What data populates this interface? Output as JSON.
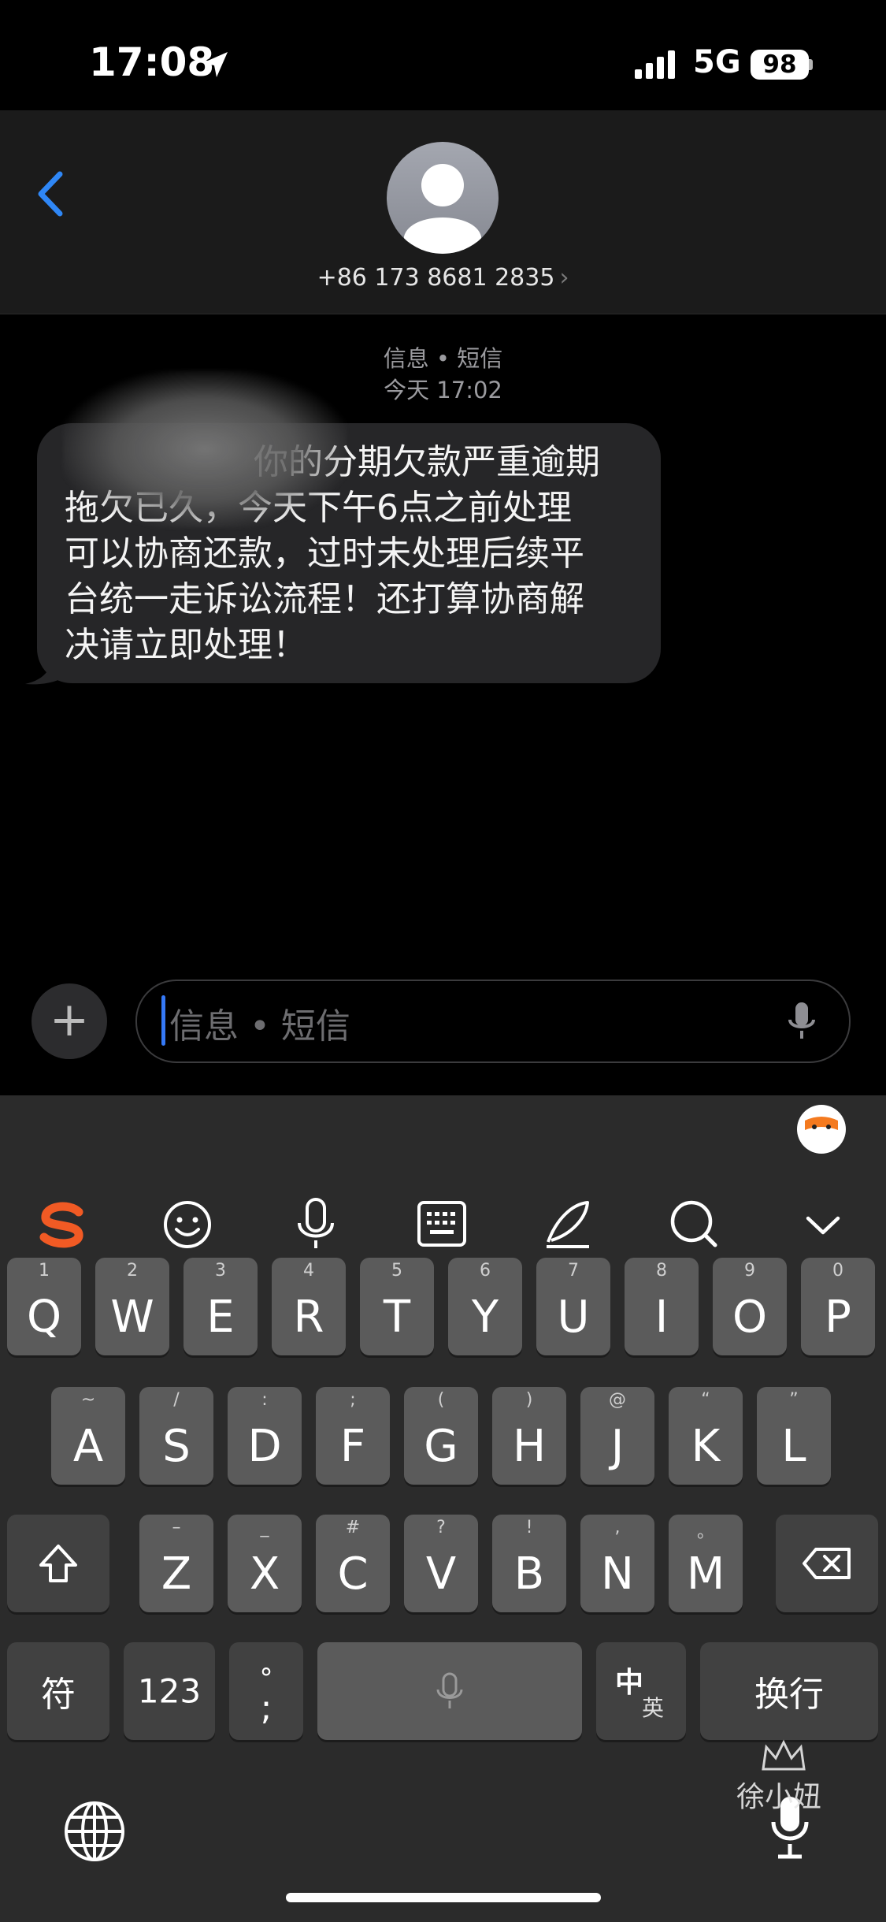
{
  "status_bar": {
    "time": "17:08",
    "network": "5G",
    "battery": "98"
  },
  "header": {
    "contact_number": "+86 173 8681 2835",
    "chevron": "›"
  },
  "conversation": {
    "service_label": "信息 • 短信",
    "timestamp": "今天 17:02",
    "message_lines": [
      "你的分期欠款严重逾期",
      "拖欠已久，今天下午6点之前处理",
      "可以协商还款，过时未处理后续平",
      "台统一走诉讼流程！还打算协商解",
      "决请立即处理！"
    ]
  },
  "input": {
    "placeholder": "信息 • 短信",
    "plus": "+"
  },
  "keyboard": {
    "toolbar_icons": [
      "sogou-logo-icon",
      "emoji-icon",
      "voice-icon",
      "keyboard-icon",
      "handwriting-icon",
      "search-icon",
      "collapse-chevron-icon"
    ],
    "row1": [
      {
        "key": "Q",
        "hint": "1"
      },
      {
        "key": "W",
        "hint": "2"
      },
      {
        "key": "E",
        "hint": "3"
      },
      {
        "key": "R",
        "hint": "4"
      },
      {
        "key": "T",
        "hint": "5"
      },
      {
        "key": "Y",
        "hint": "6"
      },
      {
        "key": "U",
        "hint": "7"
      },
      {
        "key": "I",
        "hint": "8"
      },
      {
        "key": "O",
        "hint": "9"
      },
      {
        "key": "P",
        "hint": "0"
      }
    ],
    "row2": [
      {
        "key": "A",
        "hint": "~"
      },
      {
        "key": "S",
        "hint": "/"
      },
      {
        "key": "D",
        "hint": ":"
      },
      {
        "key": "F",
        "hint": ";"
      },
      {
        "key": "G",
        "hint": "("
      },
      {
        "key": "H",
        "hint": ")"
      },
      {
        "key": "J",
        "hint": "@"
      },
      {
        "key": "K",
        "hint": "“"
      },
      {
        "key": "L",
        "hint": "”"
      }
    ],
    "row3": [
      {
        "key": "Z",
        "hint": "–"
      },
      {
        "key": "X",
        "hint": "_"
      },
      {
        "key": "C",
        "hint": "#"
      },
      {
        "key": "V",
        "hint": "?"
      },
      {
        "key": "B",
        "hint": "!"
      },
      {
        "key": "N",
        "hint": ","
      },
      {
        "key": "M",
        "hint": "。"
      }
    ],
    "bottom": {
      "symbols": "符",
      "numbers": "123",
      "punct_top": "°",
      "punct_bottom": ";",
      "lang_top": "中",
      "lang_bottom": "英",
      "return": "换行"
    }
  },
  "watermark": "徐小妞",
  "colors": {
    "accent": "#3579f6",
    "sogou": "#f15a24"
  }
}
